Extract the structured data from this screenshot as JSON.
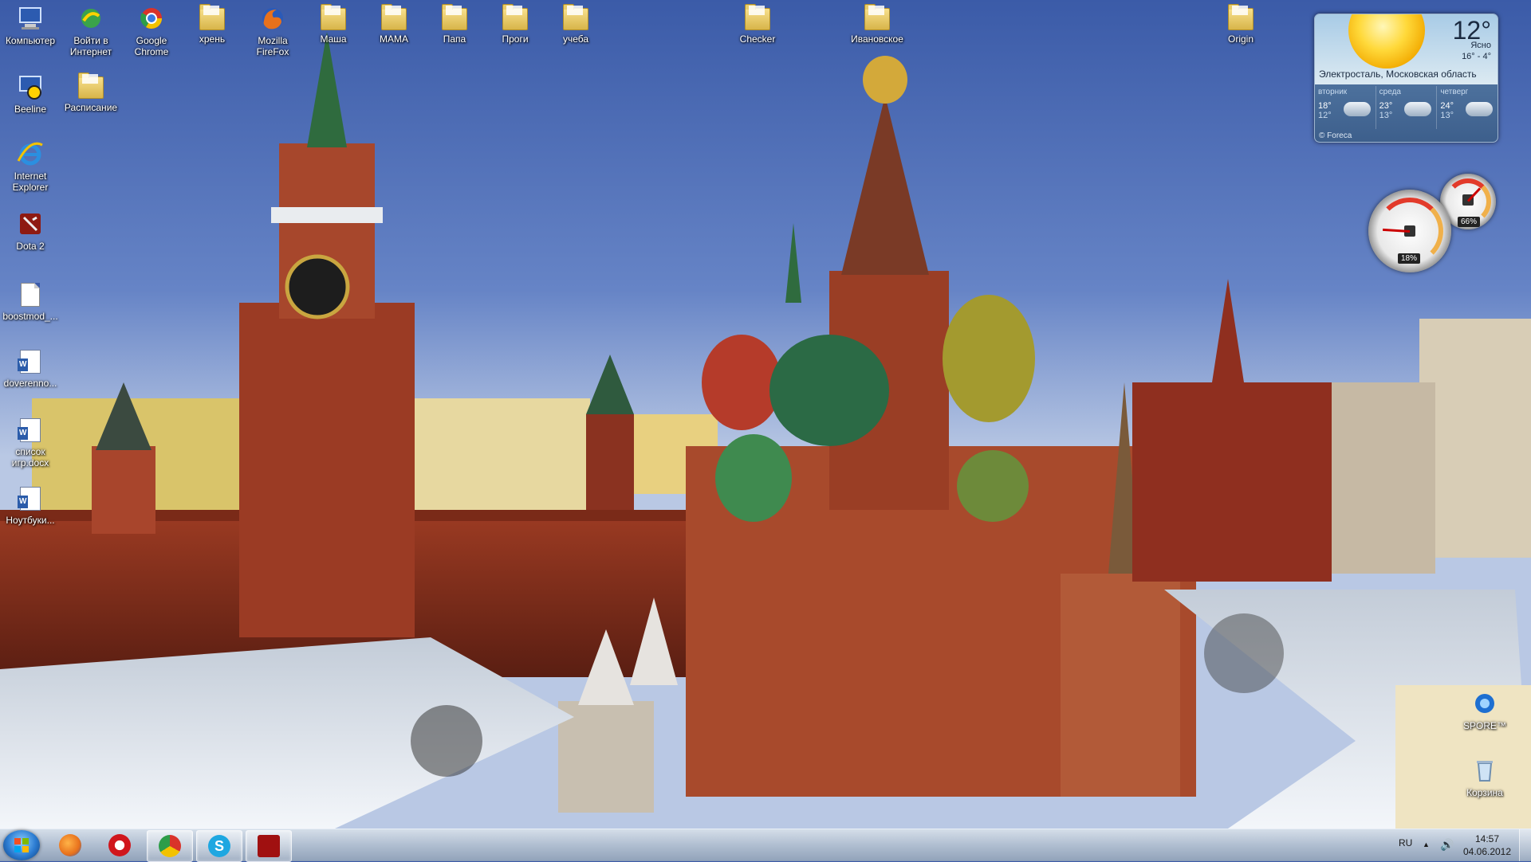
{
  "desktop": {
    "icons": [
      {
        "label": "Компьютер",
        "icon": "computer-icon"
      },
      {
        "label": "Войти в Интернет",
        "icon": "internet-connect-icon"
      },
      {
        "label": "Google Chrome",
        "icon": "chrome-icon"
      },
      {
        "label": "хрень",
        "icon": "folder-icon"
      },
      {
        "label": "Mozilla FireFox",
        "icon": "firefox-icon"
      },
      {
        "label": "Маша",
        "icon": "folder-icon"
      },
      {
        "label": "МАМА",
        "icon": "folder-icon"
      },
      {
        "label": "Папа",
        "icon": "folder-icon"
      },
      {
        "label": "Проги",
        "icon": "folder-icon"
      },
      {
        "label": "учеба",
        "icon": "folder-icon"
      },
      {
        "label": "Checker",
        "icon": "folder-icon"
      },
      {
        "label": "Ивановское",
        "icon": "folder-icon"
      },
      {
        "label": "Origin",
        "icon": "folder-icon"
      },
      {
        "label": "Beeline",
        "icon": "beeline-icon"
      },
      {
        "label": "Расписание",
        "icon": "folder-icon"
      },
      {
        "label": "Internet Explorer",
        "icon": "internet-explorer-icon"
      },
      {
        "label": "Dota 2",
        "icon": "dota2-icon"
      },
      {
        "label": "boostmod_...",
        "icon": "file-icon"
      },
      {
        "label": "doverenno...",
        "icon": "word-document-icon"
      },
      {
        "label": "список игр.docx",
        "icon": "word-document-icon"
      },
      {
        "label": "Ноутбуки...",
        "icon": "word-document-icon"
      },
      {
        "label": "SPORE™",
        "icon": "spore-icon"
      },
      {
        "label": "Корзина",
        "icon": "recycle-bin-icon"
      }
    ]
  },
  "weather_gadget": {
    "temperature": "12°",
    "condition": "Ясно",
    "range": "16° - 4°",
    "location": "Электросталь, Московская область",
    "forecast": [
      {
        "day": "вторник",
        "high": "18°",
        "low": "12°",
        "icon": "cloudy-icon"
      },
      {
        "day": "среда",
        "high": "23°",
        "low": "13°",
        "icon": "rain-icon"
      },
      {
        "day": "четверг",
        "high": "24°",
        "low": "13°",
        "icon": "rain-icon"
      }
    ],
    "provider": "© Foreca"
  },
  "meters_gadget": {
    "cpu_percent": "18%",
    "memory_percent": "66%",
    "cpu_value": 18,
    "memory_value": 66
  },
  "taskbar": {
    "pinned": [
      {
        "name": "firefox",
        "icon": "firefox-icon",
        "color": "#e8711c"
      },
      {
        "name": "opera",
        "icon": "opera-icon",
        "color": "#d0161c"
      },
      {
        "name": "chrome",
        "icon": "chrome-icon",
        "color": "#4caf50"
      },
      {
        "name": "skype",
        "icon": "skype-icon",
        "color": "#1ea7e1"
      },
      {
        "name": "dota2",
        "icon": "dota2-icon",
        "color": "#a01010"
      }
    ],
    "language": "RU",
    "time": "14:57",
    "date": "04.06.2012"
  }
}
